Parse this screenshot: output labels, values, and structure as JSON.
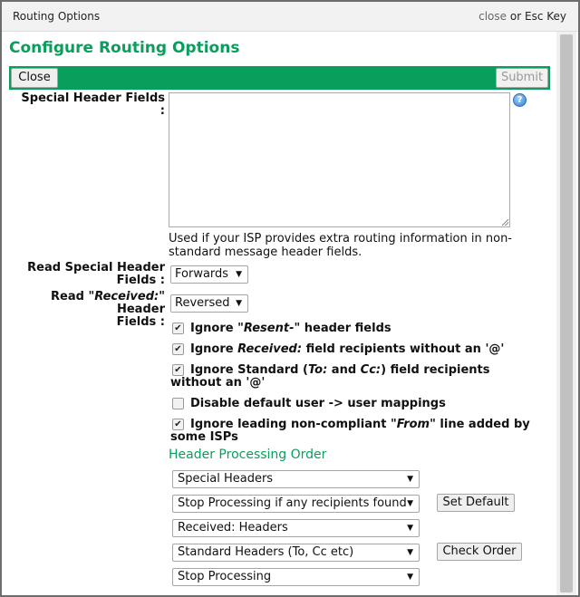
{
  "window": {
    "title": "Routing Options",
    "close_link": "close",
    "close_or": "or",
    "close_key": "Esc Key"
  },
  "heading": "Configure Routing Options",
  "toolbar": {
    "close_label": "Close",
    "submit_label": "Submit"
  },
  "special_header": {
    "label": "Special Header Fields :",
    "value": "",
    "note": "Used if your ISP provides extra routing information in non-standard message header fields.",
    "help_icon": "help-icon"
  },
  "read_special": {
    "label_line1": "Read Special Header",
    "label_line2": "Fields :",
    "value": "Forwards"
  },
  "read_received": {
    "label_pre": "Read \"",
    "label_em": "Received:",
    "label_post": "\" Header",
    "label_line2": "Fields :",
    "value": "Reversed"
  },
  "checkboxes": [
    {
      "checked": true,
      "pre": "Ignore \"",
      "em": "Resent-",
      "post": "\" header fields",
      "line2": ""
    },
    {
      "checked": true,
      "pre": "Ignore ",
      "em": "Received:",
      "post": " field recipients without an '@'",
      "line2": ""
    },
    {
      "checked": true,
      "pre": "Ignore Standard (",
      "em": "To:",
      "mid": " and ",
      "em2": "Cc:",
      "post": ") field recipients without an",
      "line2": "'@'"
    },
    {
      "checked": false,
      "pre": "Disable default user -> user mappings",
      "em": "",
      "post": "",
      "line2": ""
    },
    {
      "checked": true,
      "pre": "Ignore leading non-compliant \"",
      "em": "From",
      "post": "\" line added by some",
      "line2": "ISPs"
    }
  ],
  "order": {
    "heading": "Header Processing Order",
    "items": [
      "Special Headers",
      "Stop Processing if any recipients found",
      "Received: Headers",
      "Standard Headers (To, Cc etc)",
      "Stop Processing"
    ],
    "set_default_label": "Set Default",
    "check_order_label": "Check Order"
  }
}
